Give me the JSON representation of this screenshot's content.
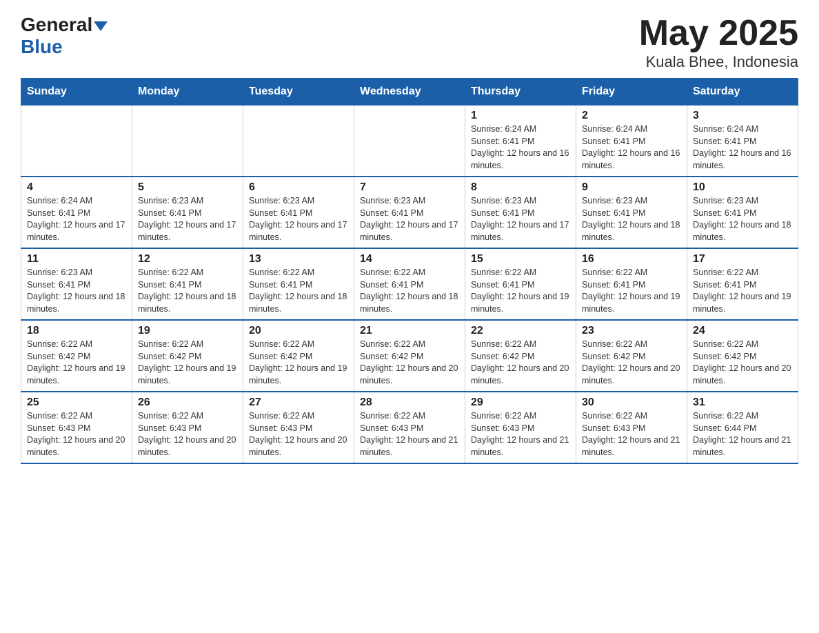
{
  "header": {
    "logo_general": "General",
    "logo_blue": "Blue",
    "title": "May 2025",
    "subtitle": "Kuala Bhee, Indonesia"
  },
  "days_of_week": [
    "Sunday",
    "Monday",
    "Tuesday",
    "Wednesday",
    "Thursday",
    "Friday",
    "Saturday"
  ],
  "weeks": [
    [
      {
        "day": "",
        "info": ""
      },
      {
        "day": "",
        "info": ""
      },
      {
        "day": "",
        "info": ""
      },
      {
        "day": "",
        "info": ""
      },
      {
        "day": "1",
        "info": "Sunrise: 6:24 AM\nSunset: 6:41 PM\nDaylight: 12 hours and 16 minutes."
      },
      {
        "day": "2",
        "info": "Sunrise: 6:24 AM\nSunset: 6:41 PM\nDaylight: 12 hours and 16 minutes."
      },
      {
        "day": "3",
        "info": "Sunrise: 6:24 AM\nSunset: 6:41 PM\nDaylight: 12 hours and 16 minutes."
      }
    ],
    [
      {
        "day": "4",
        "info": "Sunrise: 6:24 AM\nSunset: 6:41 PM\nDaylight: 12 hours and 17 minutes."
      },
      {
        "day": "5",
        "info": "Sunrise: 6:23 AM\nSunset: 6:41 PM\nDaylight: 12 hours and 17 minutes."
      },
      {
        "day": "6",
        "info": "Sunrise: 6:23 AM\nSunset: 6:41 PM\nDaylight: 12 hours and 17 minutes."
      },
      {
        "day": "7",
        "info": "Sunrise: 6:23 AM\nSunset: 6:41 PM\nDaylight: 12 hours and 17 minutes."
      },
      {
        "day": "8",
        "info": "Sunrise: 6:23 AM\nSunset: 6:41 PM\nDaylight: 12 hours and 17 minutes."
      },
      {
        "day": "9",
        "info": "Sunrise: 6:23 AM\nSunset: 6:41 PM\nDaylight: 12 hours and 18 minutes."
      },
      {
        "day": "10",
        "info": "Sunrise: 6:23 AM\nSunset: 6:41 PM\nDaylight: 12 hours and 18 minutes."
      }
    ],
    [
      {
        "day": "11",
        "info": "Sunrise: 6:23 AM\nSunset: 6:41 PM\nDaylight: 12 hours and 18 minutes."
      },
      {
        "day": "12",
        "info": "Sunrise: 6:22 AM\nSunset: 6:41 PM\nDaylight: 12 hours and 18 minutes."
      },
      {
        "day": "13",
        "info": "Sunrise: 6:22 AM\nSunset: 6:41 PM\nDaylight: 12 hours and 18 minutes."
      },
      {
        "day": "14",
        "info": "Sunrise: 6:22 AM\nSunset: 6:41 PM\nDaylight: 12 hours and 18 minutes."
      },
      {
        "day": "15",
        "info": "Sunrise: 6:22 AM\nSunset: 6:41 PM\nDaylight: 12 hours and 19 minutes."
      },
      {
        "day": "16",
        "info": "Sunrise: 6:22 AM\nSunset: 6:41 PM\nDaylight: 12 hours and 19 minutes."
      },
      {
        "day": "17",
        "info": "Sunrise: 6:22 AM\nSunset: 6:41 PM\nDaylight: 12 hours and 19 minutes."
      }
    ],
    [
      {
        "day": "18",
        "info": "Sunrise: 6:22 AM\nSunset: 6:42 PM\nDaylight: 12 hours and 19 minutes."
      },
      {
        "day": "19",
        "info": "Sunrise: 6:22 AM\nSunset: 6:42 PM\nDaylight: 12 hours and 19 minutes."
      },
      {
        "day": "20",
        "info": "Sunrise: 6:22 AM\nSunset: 6:42 PM\nDaylight: 12 hours and 19 minutes."
      },
      {
        "day": "21",
        "info": "Sunrise: 6:22 AM\nSunset: 6:42 PM\nDaylight: 12 hours and 20 minutes."
      },
      {
        "day": "22",
        "info": "Sunrise: 6:22 AM\nSunset: 6:42 PM\nDaylight: 12 hours and 20 minutes."
      },
      {
        "day": "23",
        "info": "Sunrise: 6:22 AM\nSunset: 6:42 PM\nDaylight: 12 hours and 20 minutes."
      },
      {
        "day": "24",
        "info": "Sunrise: 6:22 AM\nSunset: 6:42 PM\nDaylight: 12 hours and 20 minutes."
      }
    ],
    [
      {
        "day": "25",
        "info": "Sunrise: 6:22 AM\nSunset: 6:43 PM\nDaylight: 12 hours and 20 minutes."
      },
      {
        "day": "26",
        "info": "Sunrise: 6:22 AM\nSunset: 6:43 PM\nDaylight: 12 hours and 20 minutes."
      },
      {
        "day": "27",
        "info": "Sunrise: 6:22 AM\nSunset: 6:43 PM\nDaylight: 12 hours and 20 minutes."
      },
      {
        "day": "28",
        "info": "Sunrise: 6:22 AM\nSunset: 6:43 PM\nDaylight: 12 hours and 21 minutes."
      },
      {
        "day": "29",
        "info": "Sunrise: 6:22 AM\nSunset: 6:43 PM\nDaylight: 12 hours and 21 minutes."
      },
      {
        "day": "30",
        "info": "Sunrise: 6:22 AM\nSunset: 6:43 PM\nDaylight: 12 hours and 21 minutes."
      },
      {
        "day": "31",
        "info": "Sunrise: 6:22 AM\nSunset: 6:44 PM\nDaylight: 12 hours and 21 minutes."
      }
    ]
  ]
}
